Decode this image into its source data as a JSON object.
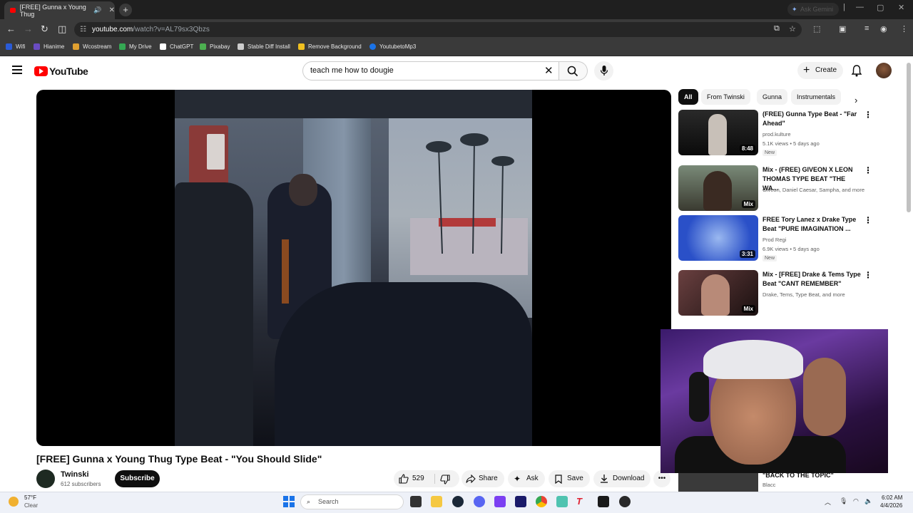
{
  "browser": {
    "tab_title": "[FREE] Gunna x Young Thug",
    "new_tab_icon": "+",
    "gemini_label": "Ask Gemini",
    "url_host": "youtube.com",
    "url_path": "/watch?v=AL79sx3Qbzs",
    "bookmarks": [
      {
        "label": "Wifi",
        "color": "#2a5bd7"
      },
      {
        "label": "Hianime",
        "color": "#6a4cc2"
      },
      {
        "label": "Wcostream",
        "color": "#e0a030"
      },
      {
        "label": "My Drive",
        "color": "#34a853"
      },
      {
        "label": "ChatGPT",
        "color": "#ffffff"
      },
      {
        "label": "Pixabay",
        "color": "#4cb050"
      },
      {
        "label": "Stable Diff Install",
        "color": "#cccccc"
      },
      {
        "label": "Remove Background",
        "color": "#f0c020"
      },
      {
        "label": "YoutubetoMp3",
        "color": "#1a73e8"
      }
    ]
  },
  "youtube": {
    "logo_text": "YouTube",
    "search_query": "teach me how to dougie",
    "create_label": "Create",
    "video_title": "[FREE] Gunna x Young Thug Type Beat - \"You Should Slide\"",
    "channel_name": "Twinski",
    "channel_subs": "612 subscribers",
    "subscribe_label": "Subscribe",
    "like_count": "529",
    "share_label": "Share",
    "ask_label": "Ask",
    "save_label": "Save",
    "download_label": "Download",
    "more_label": "•••",
    "chips": [
      "All",
      "From Twinski",
      "Gunna",
      "Instrumentals"
    ],
    "recommendations": [
      {
        "title": "(FREE) Gunna Type Beat - \"Far Ahead\"",
        "channel": "prod.kulture",
        "meta": "5.1K views • 5 days ago",
        "badge": "New",
        "duration": "8:48",
        "thumb": "#1a1a1a"
      },
      {
        "title": "Mix - (FREE) GIVEON X LEON THOMAS TYPE BEAT \"THE WA...",
        "channel": "Giveon, Daniel Caesar, Sampha, and more",
        "meta": "",
        "badge": "",
        "duration": "Mix",
        "thumb": "#3a3030"
      },
      {
        "title": "FREE Tory Lanez x Drake Type Beat \"PURE IMAGINATION ...",
        "channel": "Prod Regi",
        "meta": "6.9K views • 5 days ago",
        "badge": "New",
        "duration": "3:31",
        "thumb": "#2850c8"
      },
      {
        "title": "Mix - [FREE] Drake & Tems Type Beat \"CANT REMEMBER\"",
        "channel": "Drake, Tems, Type Beat, and more",
        "meta": "",
        "badge": "",
        "duration": "Mix",
        "thumb": "#4a2a2a"
      }
    ],
    "rec5_title": "\"BACK TO THE TOPIC\"",
    "rec5_channel": "Blacc"
  },
  "taskbar": {
    "temp": "57°F",
    "condition": "Clear",
    "search_placeholder": "Search",
    "time": "6:02 AM",
    "date": "4/4/2026"
  }
}
